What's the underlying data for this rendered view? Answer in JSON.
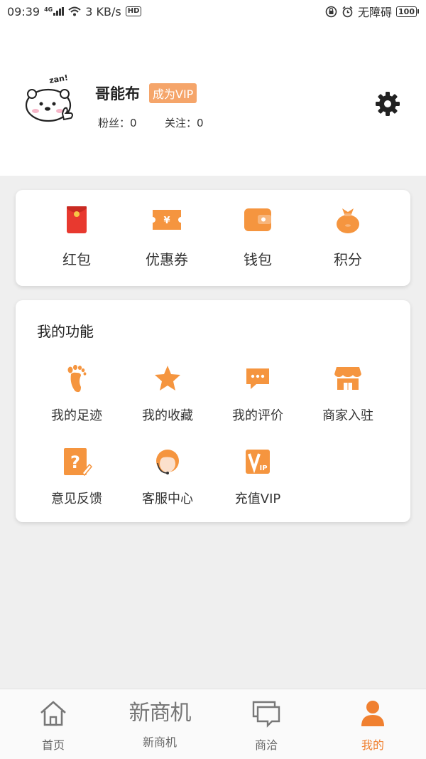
{
  "status_bar": {
    "time": "09:39",
    "network_type": "4G",
    "speed": "3 KB/s",
    "hd": "HD",
    "accessibility": "无障碍",
    "battery": "100"
  },
  "profile": {
    "username": "哥能布",
    "vip_button": "成为VIP",
    "fans": "粉丝：0",
    "following": "关注：0",
    "avatar_text": "zan!"
  },
  "quick_actions": [
    {
      "label": "红包",
      "icon": "red-envelope-icon"
    },
    {
      "label": "优惠券",
      "icon": "coupon-icon"
    },
    {
      "label": "钱包",
      "icon": "wallet-icon"
    },
    {
      "label": "积分",
      "icon": "points-bag-icon"
    }
  ],
  "functions": {
    "title": "我的功能",
    "items": [
      {
        "label": "我的足迹",
        "icon": "footprint-icon"
      },
      {
        "label": "我的收藏",
        "icon": "star-icon"
      },
      {
        "label": "我的评价",
        "icon": "comment-icon"
      },
      {
        "label": "商家入驻",
        "icon": "store-icon"
      },
      {
        "label": "意见反馈",
        "icon": "feedback-icon"
      },
      {
        "label": "客服中心",
        "icon": "customer-service-icon"
      },
      {
        "label": "充值VIP",
        "icon": "vip-icon"
      }
    ]
  },
  "bottom_nav": [
    {
      "label": "首页",
      "icon": "home-icon"
    },
    {
      "label": "新商机",
      "icon": "brand-logo",
      "logo_text": "新商机"
    },
    {
      "label": "商洽",
      "icon": "chat-icon"
    },
    {
      "label": "我的",
      "icon": "user-icon",
      "active": true
    }
  ],
  "colors": {
    "accent": "#f08030",
    "accent_light": "#f5a56a",
    "red_envelope": "#e8392f",
    "page_bg": "#efefef"
  }
}
